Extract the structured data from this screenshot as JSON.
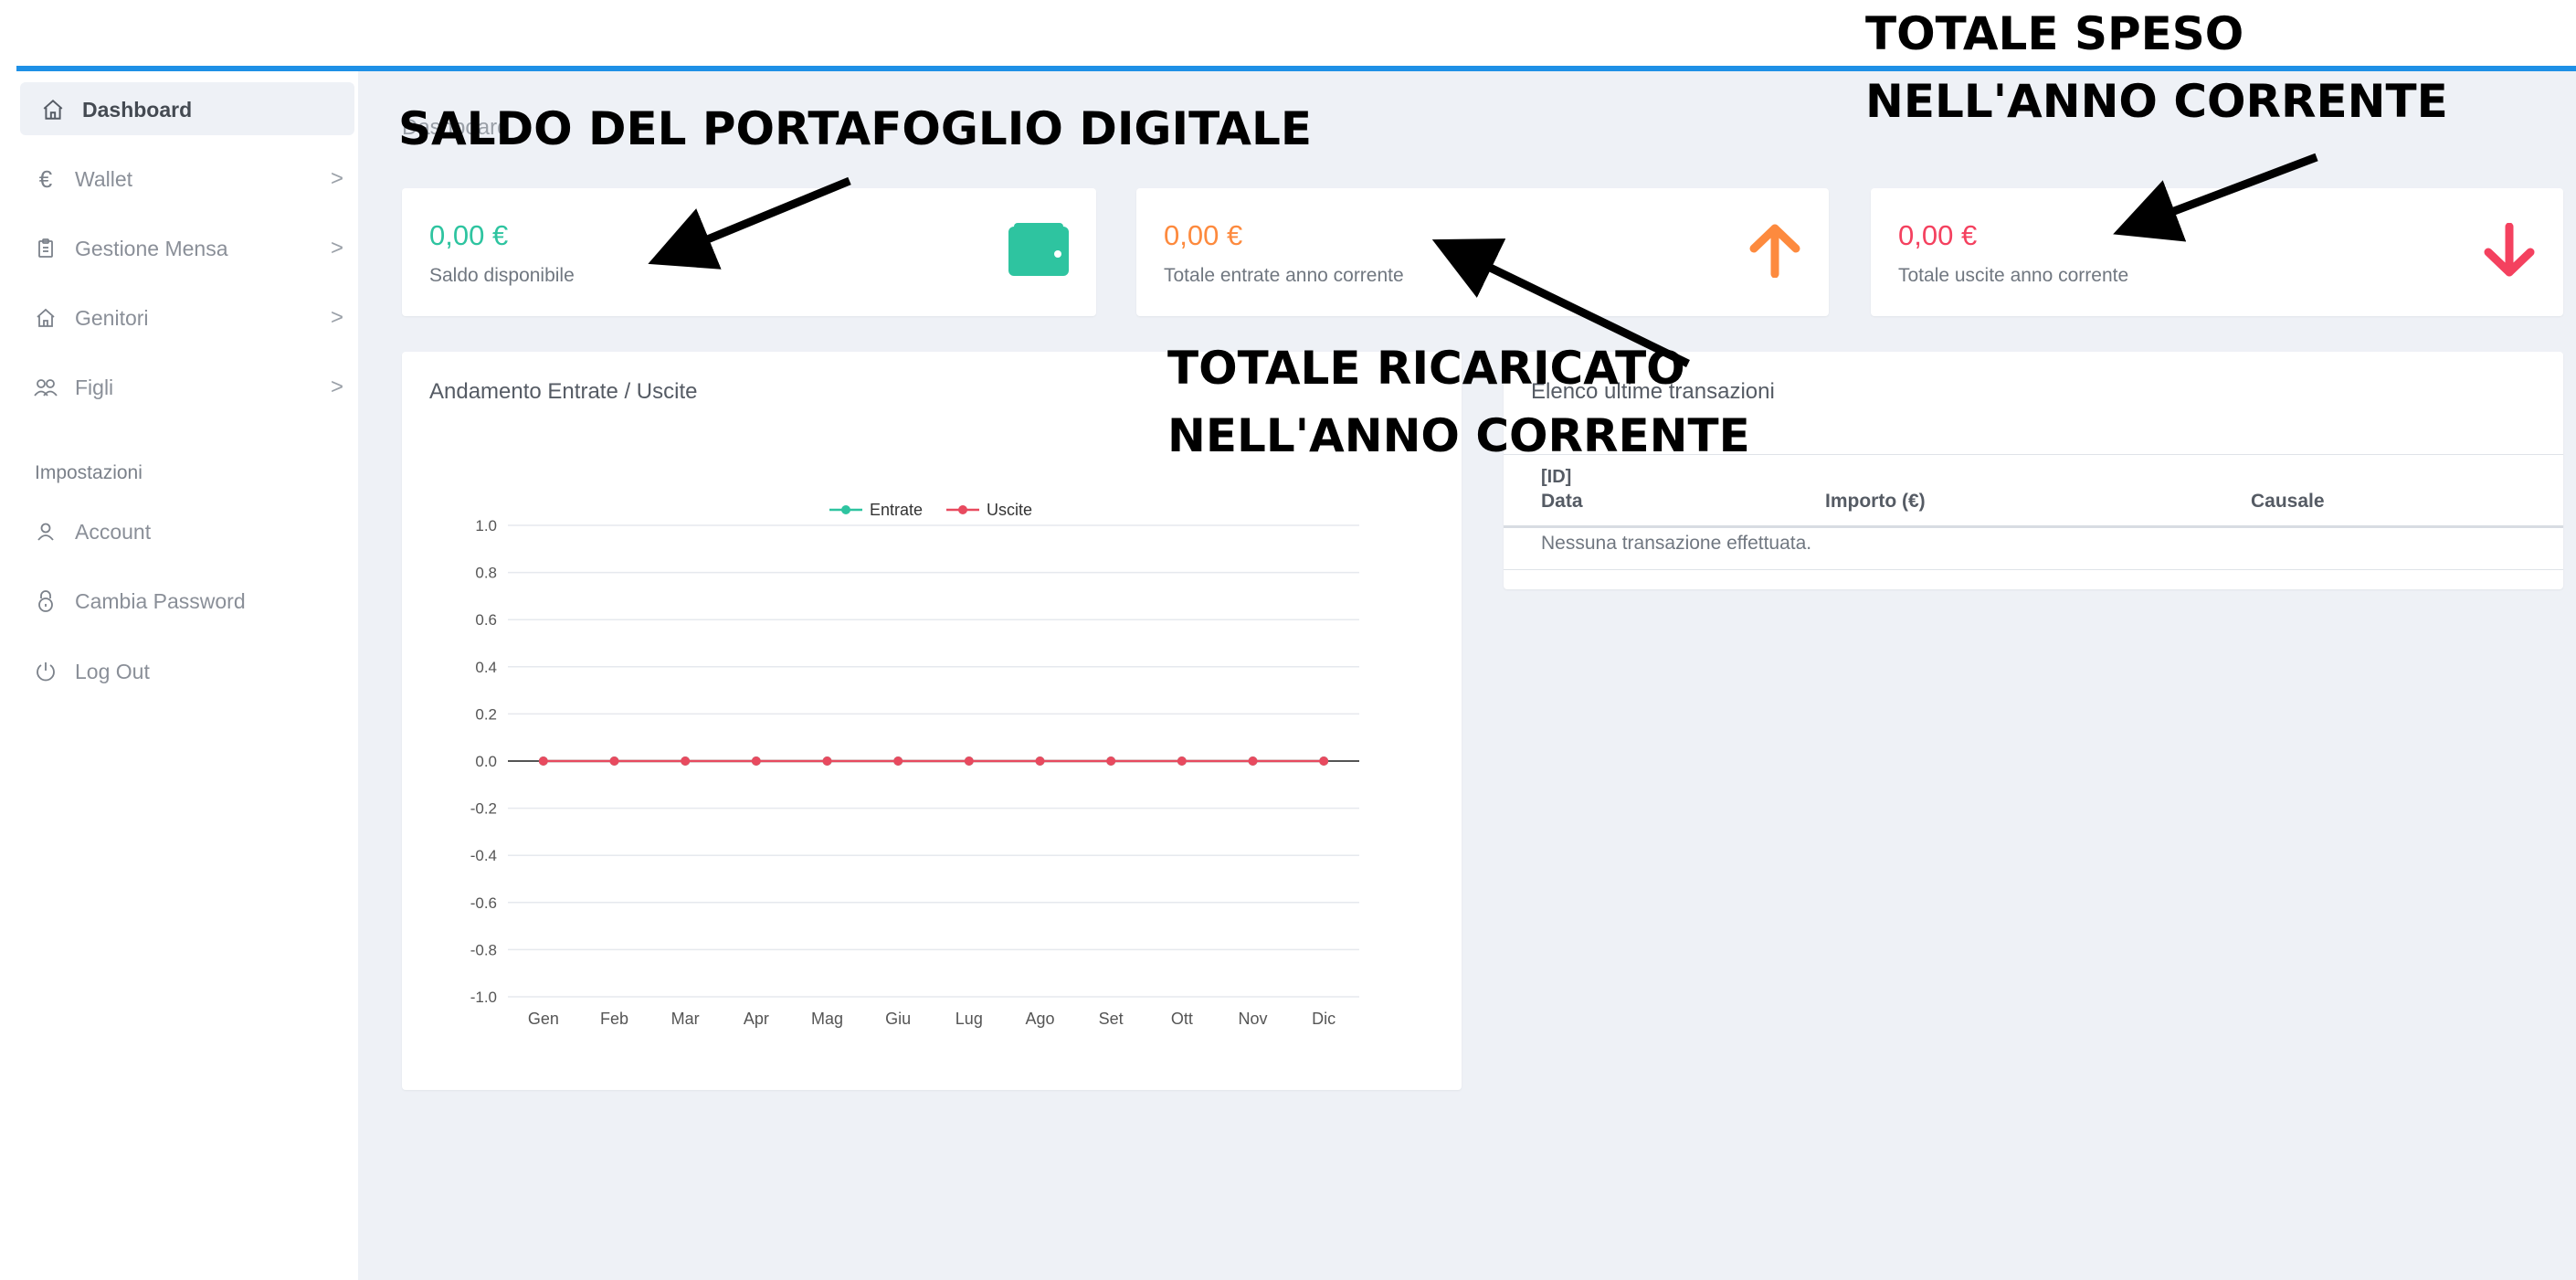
{
  "annotations": {
    "wallet_balance": "SALDO DEL PORTAFOGLIO DIGITALE",
    "total_spent_line1": "TOTALE SPESO",
    "total_spent_line2": "NELL'ANNO CORRENTE",
    "total_topped_line1": "TOTALE RICARICATO",
    "total_topped_line2": "NELL'ANNO CORRENTE"
  },
  "sidebar": {
    "items": [
      {
        "label": "Dashboard",
        "icon": "home-icon"
      },
      {
        "label": "Wallet",
        "icon": "euro-icon",
        "chevron": ">"
      },
      {
        "label": "Gestione Mensa",
        "icon": "clipboard-icon",
        "chevron": ">"
      },
      {
        "label": "Genitori",
        "icon": "home-icon",
        "chevron": ">"
      },
      {
        "label": "Figli",
        "icon": "users-icon",
        "chevron": ">"
      }
    ],
    "section_label": "Impostazioni",
    "settings": [
      {
        "label": "Account",
        "icon": "user-icon"
      },
      {
        "label": "Cambia Password",
        "icon": "lock-icon"
      },
      {
        "label": "Log Out",
        "icon": "power-icon"
      }
    ]
  },
  "breadcrumb": "Dashboard",
  "stats": [
    {
      "value": "0,00 €",
      "label": "Saldo disponibile",
      "color": "#2ec4a0",
      "icon": "wallet-icon"
    },
    {
      "value": "0,00 €",
      "label": "Totale entrate anno corrente",
      "color": "#fd8a3e",
      "icon": "arrow-up-icon"
    },
    {
      "value": "0,00 €",
      "label": "Totale uscite anno corrente",
      "color": "#f4415f",
      "icon": "arrow-down-icon"
    }
  ],
  "chart_card": {
    "title": "Andamento Entrate / Uscite"
  },
  "chart_data": {
    "type": "line",
    "categories": [
      "Gen",
      "Feb",
      "Mar",
      "Apr",
      "Mag",
      "Giu",
      "Lug",
      "Ago",
      "Set",
      "Ott",
      "Nov",
      "Dic"
    ],
    "series": [
      {
        "name": "Entrate",
        "color": "#2ec4a0",
        "values": [
          0,
          0,
          0,
          0,
          0,
          0,
          0,
          0,
          0,
          0,
          0,
          0
        ]
      },
      {
        "name": "Uscite",
        "color": "#e84a5f",
        "values": [
          0,
          0,
          0,
          0,
          0,
          0,
          0,
          0,
          0,
          0,
          0,
          0
        ]
      }
    ],
    "yticks": [
      "1.0",
      "0.8",
      "0.6",
      "0.4",
      "0.2",
      "0.0",
      "-0.2",
      "-0.4",
      "-0.6",
      "-0.8",
      "-1.0"
    ],
    "ylim": [
      -1,
      1
    ],
    "legend": "top",
    "grid": true
  },
  "transactions": {
    "title": "Elenco ultime transazioni",
    "id_header": "[ID]",
    "columns": [
      "Data",
      "Importo (€)",
      "Causale"
    ],
    "empty_message": "Nessuna transazione effettuata."
  }
}
